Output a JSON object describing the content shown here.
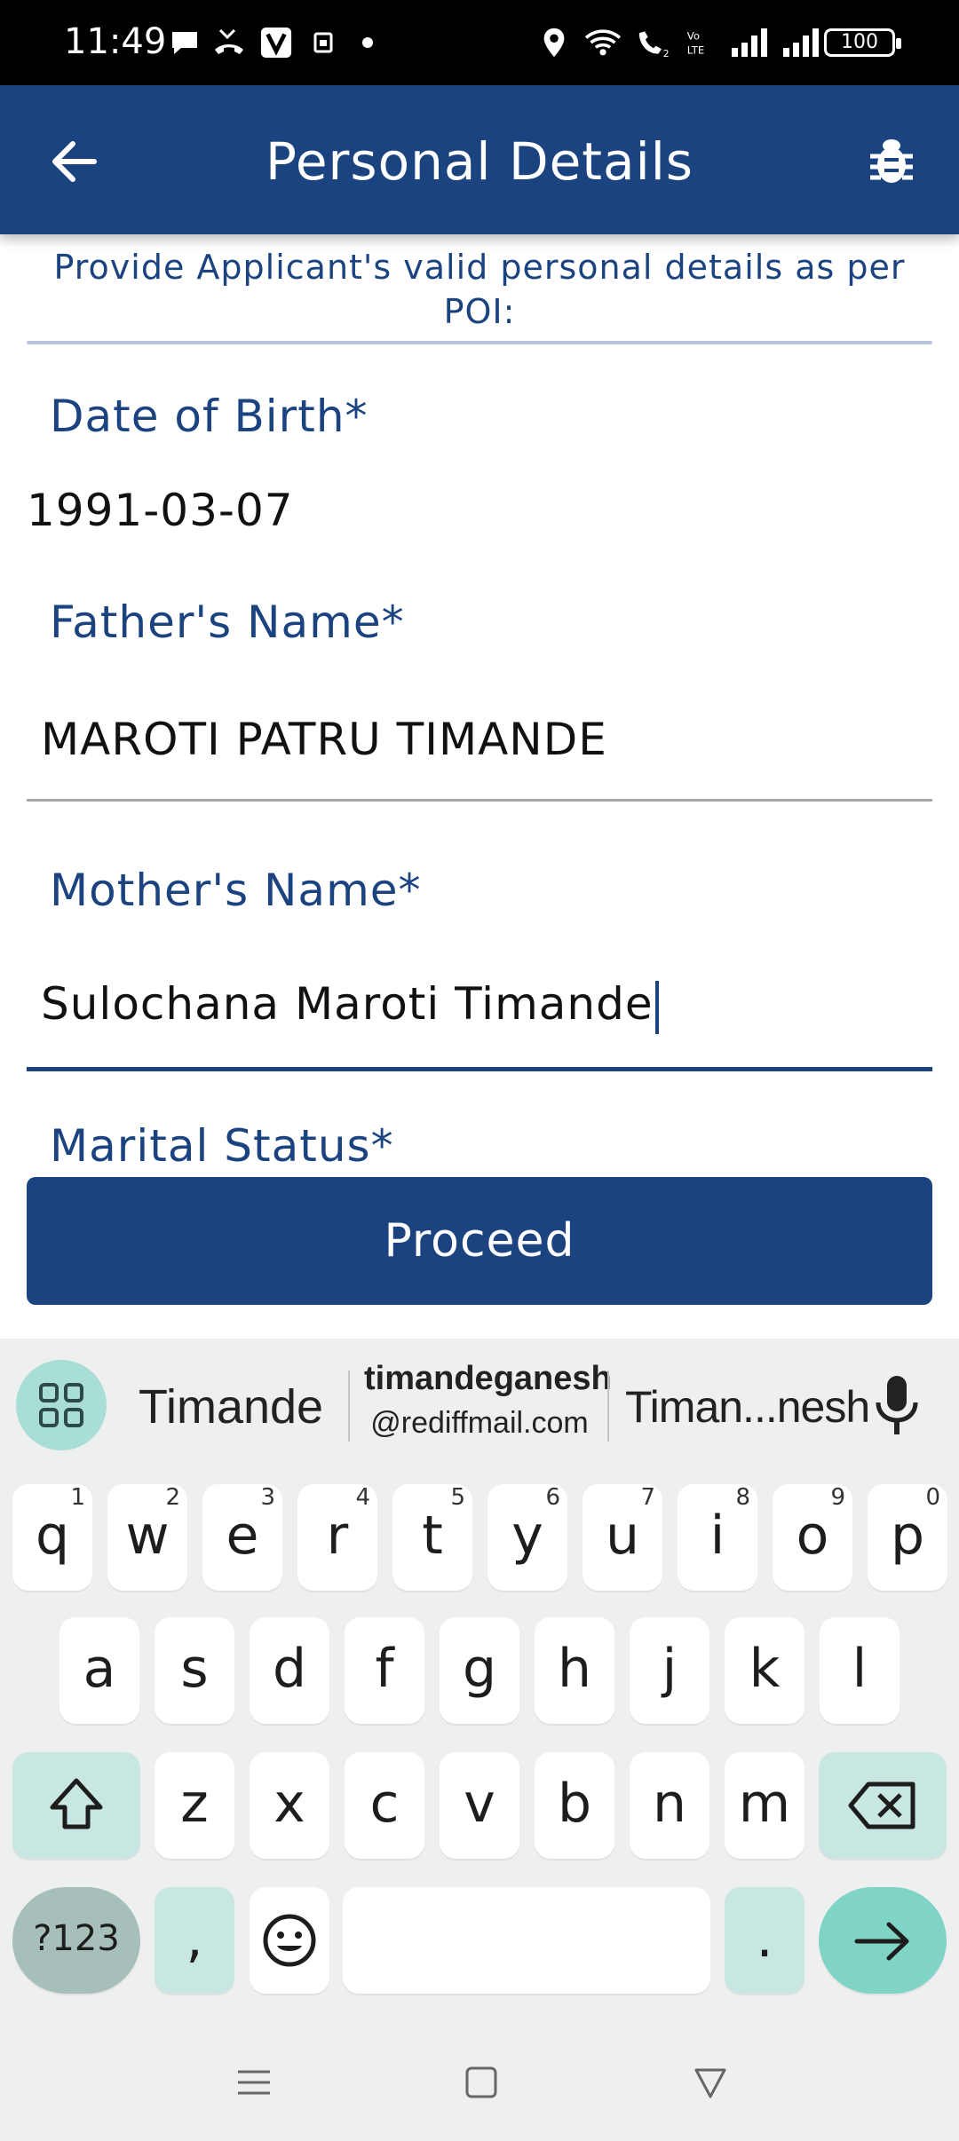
{
  "status_bar": {
    "time": "11:49",
    "battery": "100"
  },
  "app_bar": {
    "title": "Personal Details"
  },
  "form": {
    "instruction": "Provide Applicant's valid personal details as per POI:",
    "dob_label": "Date of Birth*",
    "dob_value": "1991-03-07",
    "father_label": "Father's Name*",
    "father_value": "MAROTI PATRU TIMANDE",
    "mother_label": "Mother's Name*",
    "mother_value": "Sulochana Maroti Timande",
    "marital_label": "Marital Status*",
    "proceed_label": "Proceed"
  },
  "keyboard": {
    "suggestions": {
      "first": "Timande",
      "second_line1": "timandeganesh",
      "second_line2": "@rediffmail.com",
      "third": "Timan...nesh"
    },
    "row1": [
      {
        "key": "q",
        "hint": "1"
      },
      {
        "key": "w",
        "hint": "2"
      },
      {
        "key": "e",
        "hint": "3"
      },
      {
        "key": "r",
        "hint": "4"
      },
      {
        "key": "t",
        "hint": "5"
      },
      {
        "key": "y",
        "hint": "6"
      },
      {
        "key": "u",
        "hint": "7"
      },
      {
        "key": "i",
        "hint": "8"
      },
      {
        "key": "o",
        "hint": "9"
      },
      {
        "key": "p",
        "hint": "0"
      }
    ],
    "row2": [
      "a",
      "s",
      "d",
      "f",
      "g",
      "h",
      "j",
      "k",
      "l"
    ],
    "row3": [
      "z",
      "x",
      "c",
      "v",
      "b",
      "n",
      "m"
    ],
    "symbols_label": "?123",
    "comma_label": ",",
    "period_label": "."
  },
  "colors": {
    "primary": "#1a4380",
    "keyboard_bg": "#eef0ef",
    "accent_teal": "#7fd4c6"
  }
}
